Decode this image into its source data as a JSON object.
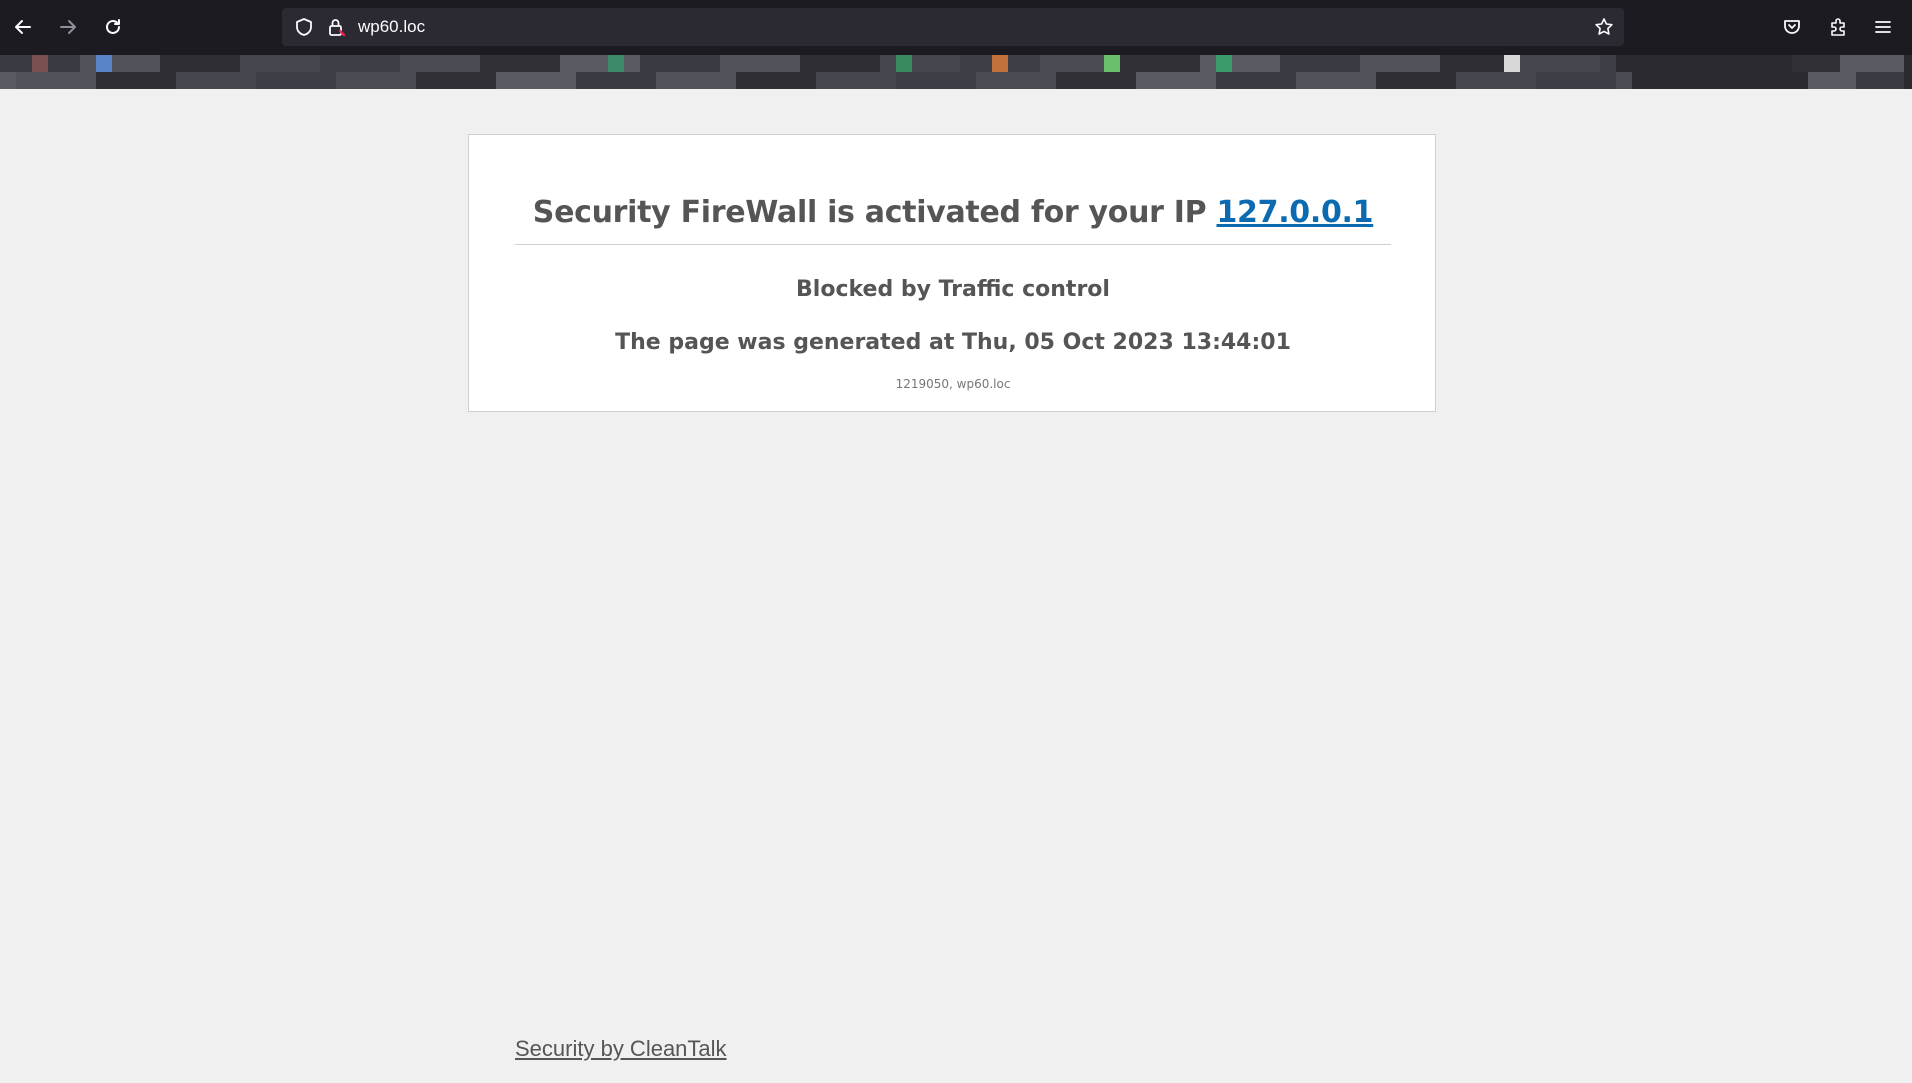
{
  "browser": {
    "url": "wp60.loc",
    "back_icon": "back-arrow-icon",
    "forward_icon": "forward-arrow-icon",
    "reload_icon": "reload-icon",
    "shield_icon": "shield-icon",
    "lock_icon": "lock-warning-icon",
    "bookmark_icon": "star-icon",
    "pocket_icon": "pocket-icon",
    "extensions_icon": "puzzle-icon",
    "menu_icon": "hamburger-menu-icon"
  },
  "page": {
    "title_prefix": "Security FireWall is activated for your IP ",
    "ip": "127.0.0.1",
    "blocked": "Blocked by Traffic control",
    "generated": "The page was generated at Thu, 05 Oct 2023 13:44:01",
    "id_line": "1219050,  wp60.loc"
  },
  "footer": {
    "link": "Security by CleanTalk"
  },
  "colors": {
    "page_bg": "#f0f0f0",
    "card_bg": "#ffffff",
    "text": "#555555",
    "link": "#0b6ab0",
    "chrome": "#1c1b22"
  }
}
